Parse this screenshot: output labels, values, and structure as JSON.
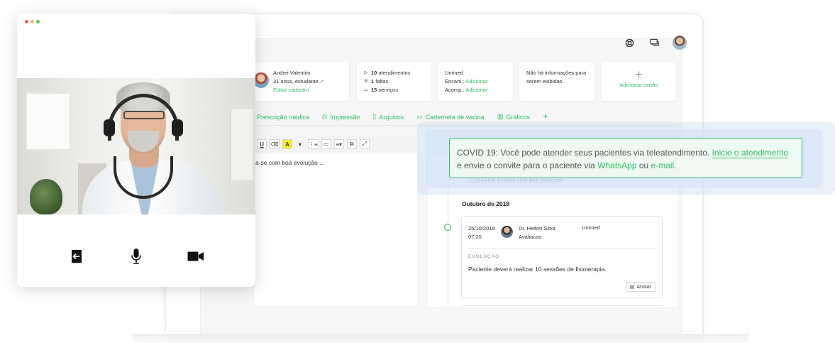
{
  "patient": {
    "name": "Andrei Valentim",
    "details": "31 anos, estudante ♂",
    "edit_link": "Editar cadastro"
  },
  "stats": {
    "items": [
      {
        "icon": "play-icon",
        "count": "10",
        "label": "atendimentos"
      },
      {
        "icon": "blocked-icon",
        "count": "1",
        "label": "faltas"
      },
      {
        "icon": "service-bell-icon",
        "count": "15",
        "label": "serviços"
      }
    ]
  },
  "insurance": {
    "name": "Unimed",
    "encam_label": "Encam.:",
    "encam_action": "Adicionar",
    "acomp_label": "Acomp.:",
    "acomp_action": "Adicionar"
  },
  "info": {
    "text": "Não há informações para serem exibidas."
  },
  "add_card": {
    "label": "Adicionar cartão"
  },
  "tabs": [
    {
      "label": "Prescrição médica",
      "icon": "prescription-icon"
    },
    {
      "label": "Impressão",
      "icon": "printer-icon"
    },
    {
      "label": "Arquivos",
      "icon": "file-icon"
    },
    {
      "label": "Caderneta de vacina",
      "icon": "vaccine-card-icon"
    },
    {
      "label": "Gráficos",
      "icon": "chart-icon"
    }
  ],
  "editor": {
    "toolbar": [
      "U",
      "⌫",
      "A"
    ],
    "text": "a-se com boa evolução ..."
  },
  "timeline": {
    "ghost_placeholder": "O paciente evoluiu com boa evolução",
    "month": "Outubro de 2018",
    "entry": {
      "date": "25/10/2018",
      "time": "07:25",
      "doctor": "Dr. Helton Silva",
      "type": "Avaliacao",
      "plan": "Unimed",
      "section_label": "EVOLUÇÃO",
      "body": "Paciente deverá realizar 10 sessões de fisioterapia.",
      "note_button": "Anotar"
    }
  },
  "notice": {
    "prefix": "COVID 19: Você pode atender seus pacientes via teleatendimento.",
    "link_start": "Inicie o atendimento",
    "middle": "e envie o convite para o paciente via",
    "link_whatsapp": "WhatsApp",
    "or": "ou",
    "link_email": "e-mail",
    "suffix": "."
  },
  "colors": {
    "accent": "#2dbd64",
    "dot_red": "#ee5f57",
    "dot_yellow": "#f5bd4f",
    "dot_green": "#5fc35d"
  }
}
